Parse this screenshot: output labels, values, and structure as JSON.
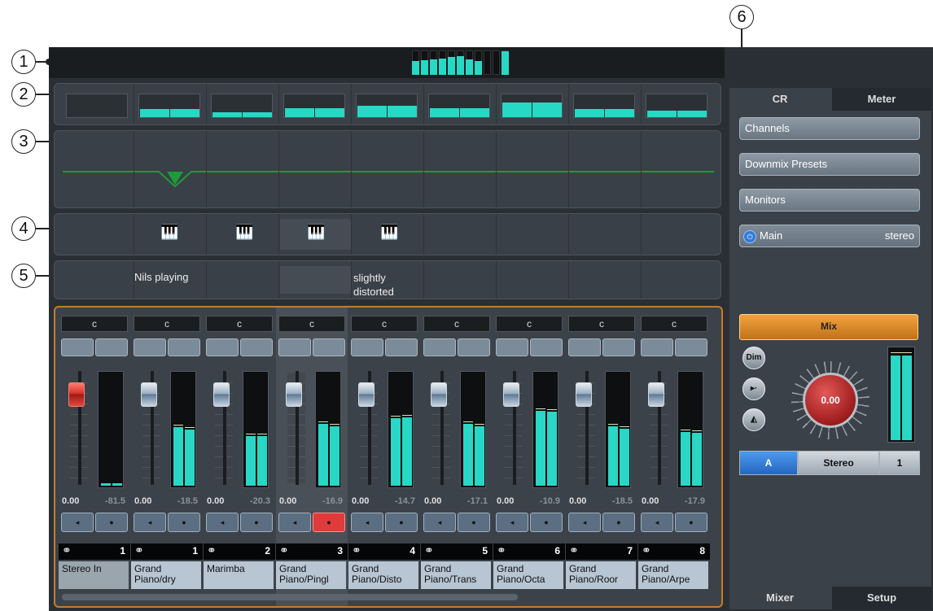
{
  "callouts": [
    "1",
    "2",
    "3",
    "4",
    "5",
    "6"
  ],
  "mixer": {
    "channels": [
      {
        "routing": "c",
        "value": "0.00",
        "peak": "-81.5",
        "number": "1",
        "name": "Stereo In",
        "selected": false,
        "fader": "red",
        "rec": false
      },
      {
        "routing": "c",
        "value": "0.00",
        "peak": "-18.5",
        "number": "1",
        "name": "Grand Piano/dry",
        "selected": false,
        "fader": "blue",
        "rec": false
      },
      {
        "routing": "c",
        "value": "0.00",
        "peak": "-20.3",
        "number": "2",
        "name": "Marimba",
        "selected": false,
        "fader": "blue",
        "rec": false
      },
      {
        "routing": "c",
        "value": "0.00",
        "peak": "-16.9",
        "number": "3",
        "name": "Grand Piano/Pingl",
        "selected": true,
        "fader": "blue",
        "rec": true
      },
      {
        "routing": "c",
        "value": "0.00",
        "peak": "-14.7",
        "number": "4",
        "name": "Grand Piano/Disto",
        "selected": false,
        "fader": "blue",
        "rec": false
      },
      {
        "routing": "c",
        "value": "0.00",
        "peak": "-17.1",
        "number": "5",
        "name": "Grand Piano/Trans",
        "selected": false,
        "fader": "blue",
        "rec": false
      },
      {
        "routing": "c",
        "value": "0.00",
        "peak": "-10.9",
        "number": "6",
        "name": "Grand Piano/Octa",
        "selected": false,
        "fader": "blue",
        "rec": false
      },
      {
        "routing": "c",
        "value": "0.00",
        "peak": "-18.5",
        "number": "7",
        "name": "Grand Piano/Roor",
        "selected": false,
        "fader": "blue",
        "rec": false
      },
      {
        "routing": "c",
        "value": "0.00",
        "peak": "-17.9",
        "number": "8",
        "name": "Grand Piano/Arpe",
        "selected": false,
        "fader": "blue",
        "rec": false
      }
    ],
    "meter_levels": [
      [
        0.02,
        0.02
      ],
      [
        0.52,
        0.5
      ],
      [
        0.44,
        0.44
      ],
      [
        0.55,
        0.53
      ],
      [
        0.6,
        0.61
      ],
      [
        0.55,
        0.53
      ],
      [
        0.67,
        0.66
      ],
      [
        0.53,
        0.51
      ],
      [
        0.48,
        0.47
      ]
    ],
    "overview_levels": [
      [
        0,
        0
      ],
      [
        0.35,
        0.35
      ],
      [
        0.2,
        0.2
      ],
      [
        0.4,
        0.4
      ],
      [
        0.5,
        0.5
      ],
      [
        0.4,
        0.4
      ],
      [
        0.65,
        0.65
      ],
      [
        0.35,
        0.35
      ],
      [
        0.3,
        0.3
      ]
    ],
    "top_meter_levels": [
      0.55,
      0.6,
      0.62,
      0.66,
      0.72,
      0.76,
      0.62,
      0.55,
      0,
      0,
      0.95
    ]
  },
  "notes": {
    "ch1": "Nils playing",
    "ch4": "slightly distorted"
  },
  "right_panel": {
    "tab_cr": "CR",
    "tab_meter": "Meter",
    "channels": "Channels",
    "downmix": "Downmix Presets",
    "monitors": "Monitors",
    "main_label": "Main",
    "main_format": "stereo",
    "mix": "Mix",
    "dim": "Dim",
    "knob_value": "0.00",
    "sel_a": "A",
    "sel_stereo": "Stereo",
    "sel_one": "1",
    "tab_mixer": "Mixer",
    "tab_setup": "Setup"
  },
  "colors": {
    "accent": "#27d9c5",
    "border": "#c87c23",
    "mix": "#e6962f",
    "power": "#2f7bd8"
  }
}
